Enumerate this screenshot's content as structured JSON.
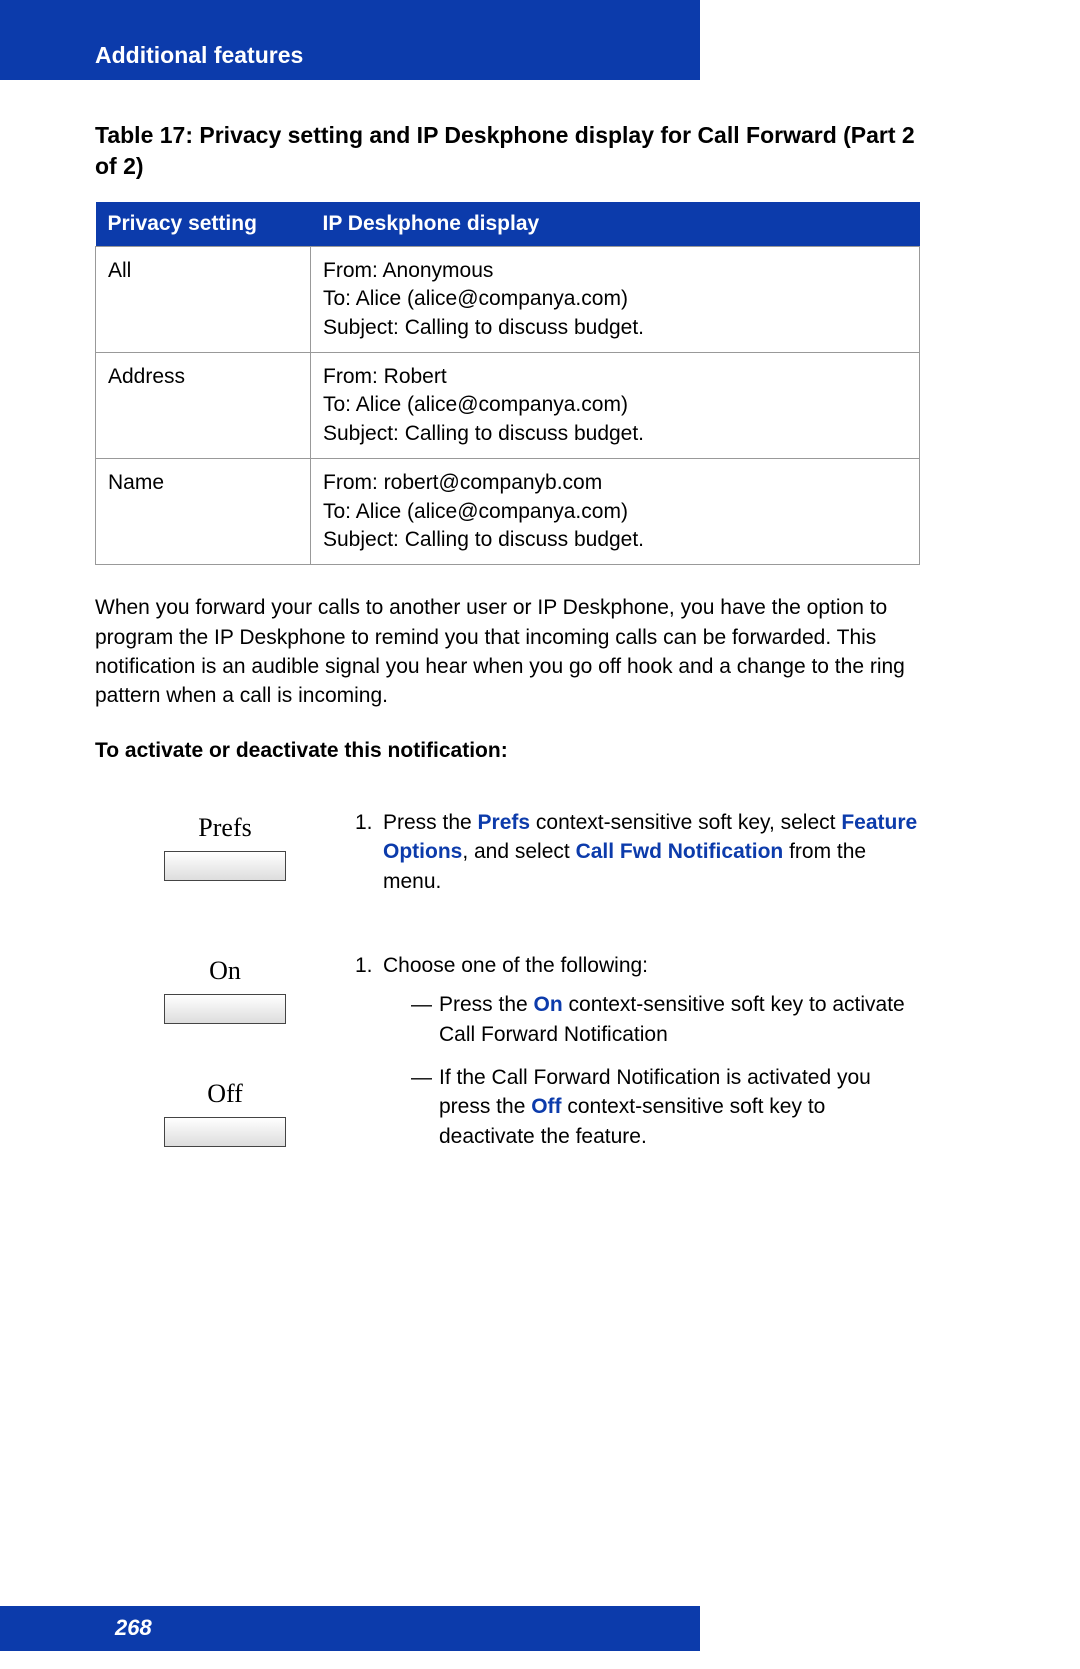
{
  "header": {
    "section": "Additional features"
  },
  "tableTitle": "Table 17: Privacy setting and IP Deskphone display for Call Forward (Part 2 of 2)",
  "table": {
    "headers": [
      "Privacy setting",
      "IP Deskphone display"
    ],
    "rows": [
      {
        "setting": "All",
        "display": {
          "from": "From: Anonymous",
          "to": "To: Alice (alice@companya.com)",
          "subject": "Subject: Calling to discuss budget."
        }
      },
      {
        "setting": "Address",
        "display": {
          "from": "From: Robert",
          "to": "To: Alice (alice@companya.com)",
          "subject": "Subject: Calling to discuss budget."
        }
      },
      {
        "setting": "Name",
        "display": {
          "from": "From: robert@companyb.com",
          "to": "To: Alice (alice@companya.com)",
          "subject": "Subject: Calling to discuss budget."
        }
      }
    ]
  },
  "paragraph": "When you forward your calls to another user or IP Deskphone, you have the option to program the IP Deskphone to remind you that incoming calls can be forwarded. This notification is an audible signal you hear when you go off hook and a change to the ring pattern when a call is incoming.",
  "instructionTitle": "To activate or deactivate this notification:",
  "softkeys": {
    "prefs": "Prefs",
    "on": "On",
    "off": "Off"
  },
  "step1": {
    "num": "1.",
    "pre1": "Press the ",
    "link1": "Prefs",
    "mid1": " context-sensitive soft key, select ",
    "link2": "Feature Options",
    "mid2": ", and select ",
    "link3": "Call Fwd Notification",
    "post": " from the menu."
  },
  "step2": {
    "num": "1.",
    "intro": "Choose one of the following:",
    "a": {
      "dash": "—",
      "pre": "Press the ",
      "link": "On",
      "post": " context-sensitive soft key to activate Call Forward Notification"
    },
    "b": {
      "dash": "—",
      "pre": "If the Call Forward Notification is activated you press the ",
      "link": "Off",
      "post": " context-sensitive soft key to deactivate the feature."
    }
  },
  "footer": {
    "page": "268"
  }
}
